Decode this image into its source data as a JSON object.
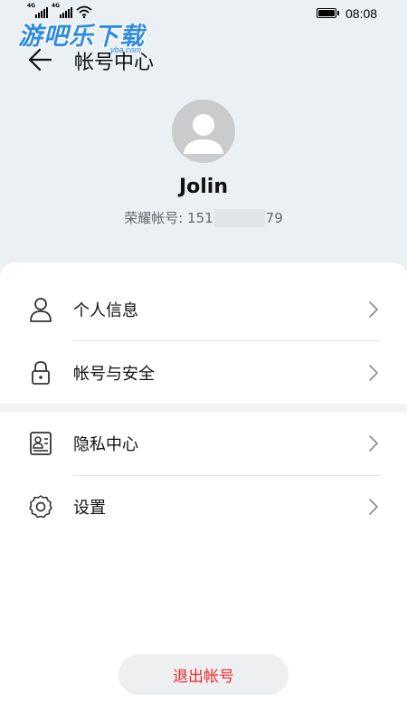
{
  "status_bar": {
    "network_1": "4G",
    "network_2": "4G",
    "time": "08:08"
  },
  "watermark": {
    "text": "游吧乐下载",
    "sub": "yba.com"
  },
  "header": {
    "title": "帐号中心"
  },
  "profile": {
    "name": "Jolin",
    "account_label": "荣耀帐号: 151",
    "account_suffix": "79"
  },
  "menu": {
    "items": [
      {
        "label": "个人信息",
        "icon": "person-icon"
      },
      {
        "label": "帐号与安全",
        "icon": "lock-icon"
      },
      {
        "label": "隐私中心",
        "icon": "id-card-icon"
      },
      {
        "label": "设置",
        "icon": "gear-icon"
      }
    ]
  },
  "logout": {
    "label": "退出帐号"
  },
  "colors": {
    "background": "#ebf0f4",
    "card": "#ffffff",
    "logout_text": "#e62b2b",
    "logout_bg": "#eeeff1"
  }
}
